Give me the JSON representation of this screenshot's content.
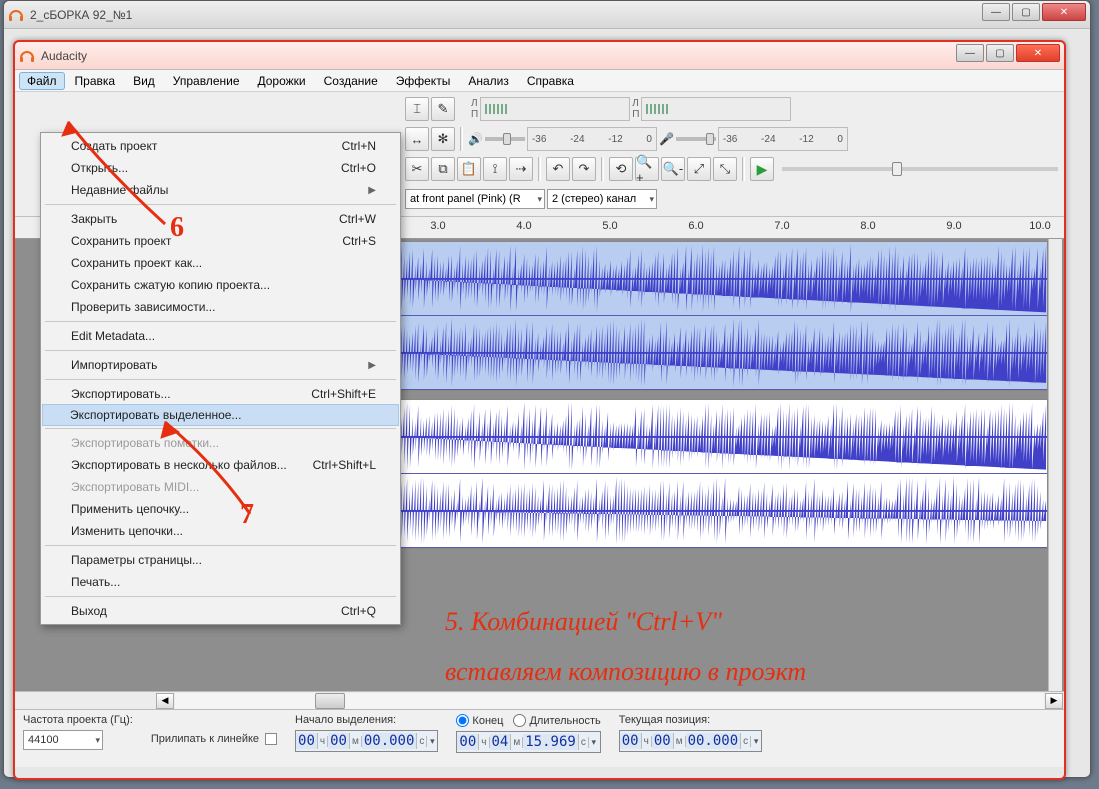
{
  "bg_window": {
    "title": "2_сБОРКА 92_№1"
  },
  "main_window": {
    "title": "Audacity",
    "menubar": [
      "Файл",
      "Правка",
      "Вид",
      "Управление",
      "Дорожки",
      "Создание",
      "Эффекты",
      "Анализ",
      "Справка"
    ],
    "meter_ticks": [
      "-36",
      "-24",
      "-12",
      "0"
    ],
    "device_combo1": "at front panel (Pink) (R",
    "device_combo2": "2 (стерео) канал",
    "ruler": [
      "3.0",
      "4.0",
      "5.0",
      "6.0",
      "7.0",
      "8.0",
      "9.0",
      "10.0"
    ]
  },
  "file_menu": [
    {
      "label": "Создать проект",
      "accel": "Ctrl+N"
    },
    {
      "label": "Открыть...",
      "accel": "Ctrl+O"
    },
    {
      "label": "Недавние файлы",
      "sub": true
    },
    {
      "sep": true
    },
    {
      "label": "Закрыть",
      "accel": "Ctrl+W"
    },
    {
      "label": "Сохранить проект",
      "accel": "Ctrl+S"
    },
    {
      "label": "Сохранить проект как..."
    },
    {
      "label": "Сохранить сжатую копию проекта..."
    },
    {
      "label": "Проверить зависимости..."
    },
    {
      "sep": true
    },
    {
      "label": "Edit Metadata..."
    },
    {
      "sep": true
    },
    {
      "label": "Импортировать",
      "sub": true
    },
    {
      "sep": true
    },
    {
      "label": "Экспортировать...",
      "accel": "Ctrl+Shift+E"
    },
    {
      "label": "Экспортировать выделенное...",
      "hi": true
    },
    {
      "sep": true
    },
    {
      "label": "Экспортировать пометки...",
      "dis": true
    },
    {
      "label": "Экспортировать в несколько файлов...",
      "accel": "Ctrl+Shift+L"
    },
    {
      "label": "Экспортировать MIDI...",
      "dis": true
    },
    {
      "label": "Применить цепочку..."
    },
    {
      "label": "Изменить цепочки..."
    },
    {
      "sep": true
    },
    {
      "label": "Параметры страницы..."
    },
    {
      "label": "Печать..."
    },
    {
      "sep": true
    },
    {
      "label": "Выход",
      "accel": "Ctrl+Q"
    }
  ],
  "status": {
    "rate_label": "Частота проекта (Гц):",
    "rate_value": "44100",
    "snap_label": "Прилипать к линейке",
    "sel_start_label": "Начало выделения:",
    "end_label": "Конец",
    "len_label": "Длительность",
    "pos_label": "Текущая позиция:",
    "t_start": {
      "h": "00",
      "m": "00",
      "s": "00.000"
    },
    "t_end": {
      "h": "00",
      "m": "04",
      "s": "15.969"
    },
    "t_pos": {
      "h": "00",
      "m": "00",
      "s": "00.000"
    }
  },
  "annotations": {
    "n6": "6",
    "n7": "7",
    "line1": "5. Комбинацией \"Ctrl+V\"",
    "line2": "вставляем композицию в проэкт"
  }
}
